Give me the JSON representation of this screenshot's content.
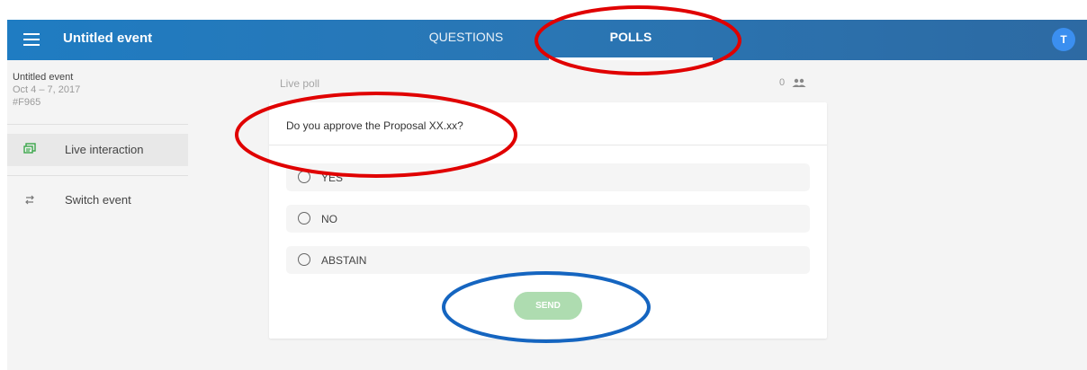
{
  "header": {
    "title": "Untitled event",
    "tabs": [
      {
        "label": "QUESTIONS"
      },
      {
        "label": "POLLS",
        "active": true
      }
    ],
    "avatar_initial": "T"
  },
  "sidebar": {
    "event_name": "Untitled event",
    "event_dates": "Oct 4 – 7, 2017",
    "event_code": "#F965",
    "items": [
      {
        "label": "Live interaction",
        "icon": "chat-icon",
        "active": true
      },
      {
        "label": "Switch event",
        "icon": "swap-icon"
      }
    ]
  },
  "poll": {
    "section_label": "Live poll",
    "participant_count": "0",
    "question": "Do you approve the Proposal XX.xx?",
    "options": [
      {
        "label": "YES"
      },
      {
        "label": "NO"
      },
      {
        "label": "ABSTAIN"
      }
    ],
    "send_label": "SEND"
  },
  "colors": {
    "header_blue": "#2a76b4",
    "avatar_blue": "#3b8ff0",
    "send_green": "#aedcb0",
    "annotation_red": "#e00000",
    "annotation_blue": "#1565c0"
  }
}
